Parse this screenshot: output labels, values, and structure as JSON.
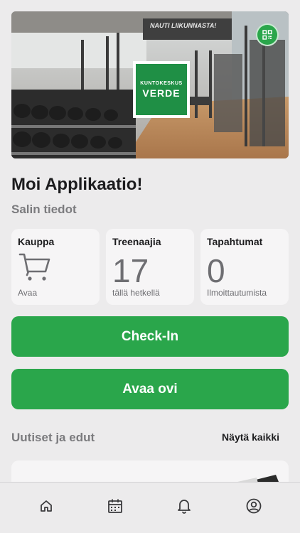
{
  "hero": {
    "logo_top": "KUNTOKESKUS",
    "logo_main": "VERDE",
    "wall_text": "NAUTI LIIKUNNASTA!",
    "qr_icon": "qr-code-icon"
  },
  "greeting": "Moi Applikaatio!",
  "section_title": "Salin tiedot",
  "cards": [
    {
      "title": "Kauppa",
      "icon": "cart-icon",
      "sub": "Avaa"
    },
    {
      "title": "Treenaajia",
      "value": "17",
      "sub": "tällä hetkellä"
    },
    {
      "title": "Tapahtumat",
      "value": "0",
      "sub": "Ilmoittautumista"
    }
  ],
  "buttons": {
    "checkin": "Check-In",
    "open_door": "Avaa ovi"
  },
  "news": {
    "title": "Uutiset ja edut",
    "show_all": "Näytä kaikki"
  },
  "tabbar": {
    "items": [
      "home-icon",
      "calendar-icon",
      "bell-icon",
      "profile-icon"
    ]
  },
  "colors": {
    "accent": "#2aa64b",
    "background": "#ecebec",
    "card": "#f6f5f6"
  }
}
